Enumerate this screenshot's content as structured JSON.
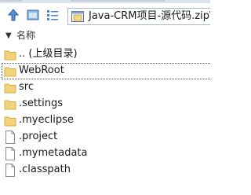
{
  "toolbar": {
    "up_icon": "up-arrow-icon",
    "window_icon": "window-icon",
    "list_icon": "list-view-icon",
    "address_text": "Java-CRM项目-源代码.zip\\it"
  },
  "columns": {
    "name_label": "名称",
    "sort_icon": "sort-down-arrow-icon"
  },
  "files": [
    {
      "name": ".. (上级目录)",
      "type": "folder"
    },
    {
      "name": "WebRoot",
      "type": "folder",
      "selected": true
    },
    {
      "name": "src",
      "type": "folder"
    },
    {
      "name": ".settings",
      "type": "folder"
    },
    {
      "name": ".myeclipse",
      "type": "folder"
    },
    {
      "name": ".project",
      "type": "file"
    },
    {
      "name": ".mymetadata",
      "type": "file"
    },
    {
      "name": ".classpath",
      "type": "file"
    }
  ],
  "colors": {
    "folder": "#f3d37a",
    "folder_dark": "#d8ae43",
    "accent": "#4a86c8"
  }
}
